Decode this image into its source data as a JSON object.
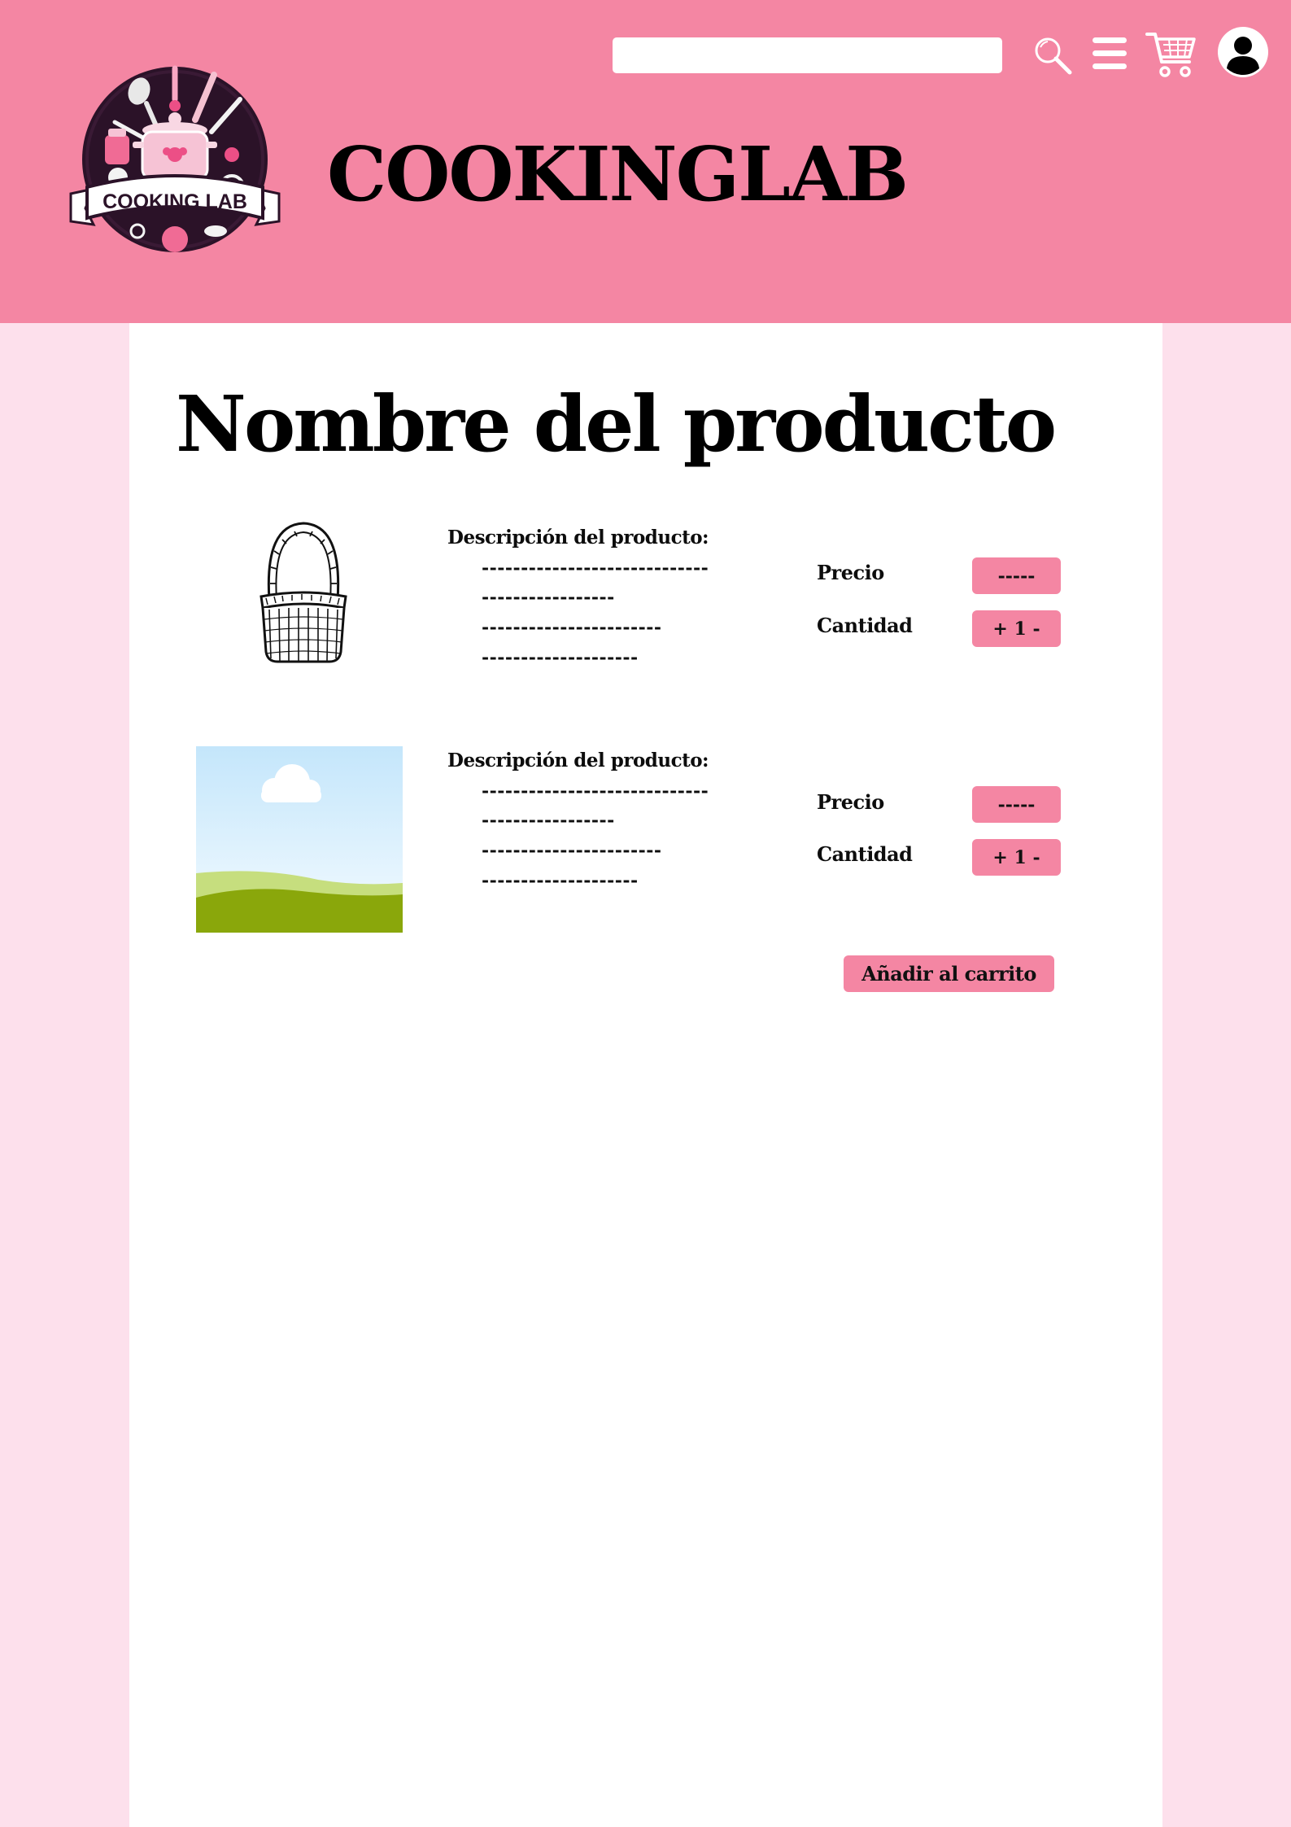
{
  "header": {
    "brand": "COOKINGLAB",
    "logo_text": "COOKING LAB",
    "search": {
      "value": "",
      "placeholder": ""
    },
    "icons": [
      "search-icon",
      "menu-icon",
      "cart-icon",
      "user-icon"
    ],
    "background_color": "#f486a3"
  },
  "page": {
    "title": "Nombre del producto",
    "side_background": "#fde0ec",
    "content_background": "#ffffff"
  },
  "products": [
    {
      "image": "basket-image",
      "description_title": "Descripción del producto:",
      "description_lines": [
        "-----------------------------",
        "-----------------",
        "-----------------------",
        "--------------------"
      ],
      "price_label": "Precio",
      "price_value": "-----",
      "quantity_label": "Cantidad",
      "quantity_value": "+ 1 -"
    },
    {
      "image": "landscape-placeholder-image",
      "description_title": "Descripción del producto:",
      "description_lines": [
        "-----------------------------",
        "-----------------",
        "-----------------------",
        "--------------------"
      ],
      "price_label": "Precio",
      "price_value": "-----",
      "quantity_label": "Cantidad",
      "quantity_value": "+ 1 -"
    }
  ],
  "actions": {
    "add_to_cart": "Añadir al carrito",
    "accent_color": "#f486a3"
  }
}
